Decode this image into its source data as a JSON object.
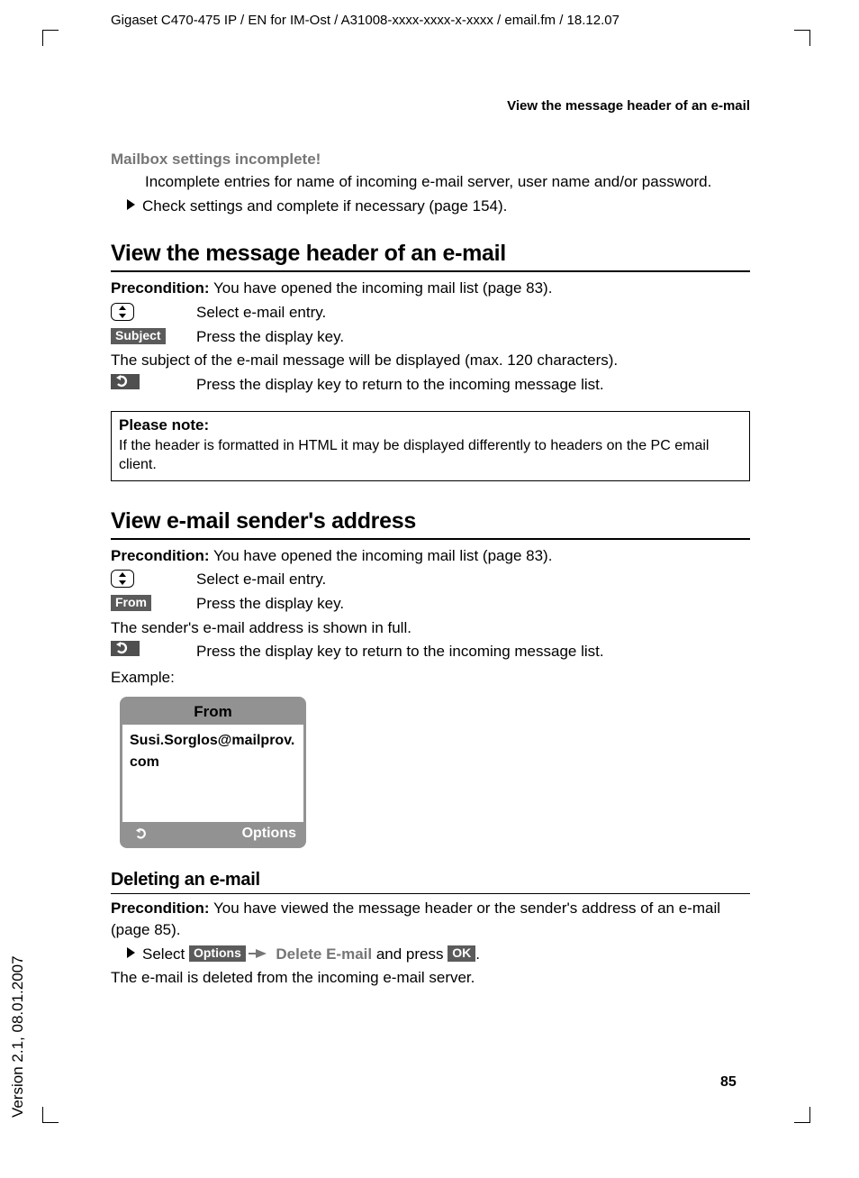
{
  "doc_header": "Gigaset C470-475 IP / EN for IM-Ost / A31008-xxxx-xxxx-x-xxxx / email.fm / 18.12.07",
  "running_head": "View the message header of an e-mail",
  "version_text": "Version 2.1, 08.01.2007",
  "page_number": "85",
  "warning": {
    "title": "Mailbox settings incomplete!",
    "line1": "Incomplete entries for name of incoming e-mail server, user name and/or password.",
    "line2": "Check settings and complete if necessary (page 154)."
  },
  "section1": {
    "title": "View the message header of an e-mail",
    "precond_label": "Precondition:",
    "precond_text": " You have opened the incoming mail list (page 83).",
    "step1": "Select e-mail entry.",
    "subject_key": "Subject",
    "step2": "Press the display key.",
    "after": "The subject of the e-mail message will be displayed (max. 120 characters).",
    "step3": "Press the display key to return to the incoming message list.",
    "note_title": "Please note:",
    "note_body": "If the header is formatted in HTML it may be displayed differently to headers on the PC email client."
  },
  "section2": {
    "title": "View e-mail sender's address",
    "precond_label": "Precondition:",
    "precond_text": " You have opened the incoming mail list (page 83).",
    "step1": "Select e-mail entry.",
    "from_key": "From",
    "step2": "Press the display key.",
    "after": "The sender's e-mail address is shown in full.",
    "step3": "Press the display key to return to the incoming message list.",
    "example_label": "Example:",
    "screen_title": "From",
    "screen_body": "Susi.Sorglos@mailprov.com",
    "screen_options": "Options"
  },
  "section3": {
    "title": "Deleting an e-mail",
    "precond_label": "Precondition:",
    "precond_text": " You have viewed the message header or the sender's address of an e-mail (page 85).",
    "select_word": "Select ",
    "options_key": "Options",
    "delete_menu": "Delete E-mail",
    "and_press": " and press ",
    "ok_key": "OK",
    "period": ".",
    "after": "The e-mail is deleted from the incoming e-mail server."
  }
}
